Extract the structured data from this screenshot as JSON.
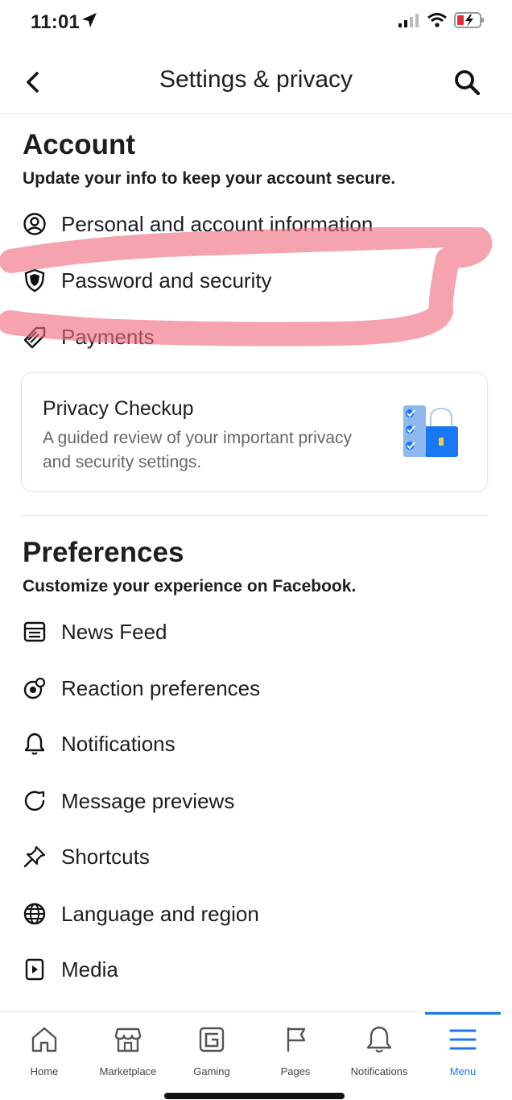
{
  "status": {
    "time": "11:01"
  },
  "header": {
    "title": "Settings & privacy"
  },
  "account": {
    "title": "Account",
    "subtitle": "Update your info to keep your account secure.",
    "items": [
      {
        "label": "Personal and account information",
        "icon": "user-circle-icon"
      },
      {
        "label": "Password and security",
        "icon": "shield-icon"
      },
      {
        "label": "Payments",
        "icon": "tag-icon"
      }
    ]
  },
  "privacy_card": {
    "title": "Privacy Checkup",
    "description": "A guided review of your important privacy and security settings."
  },
  "preferences": {
    "title": "Preferences",
    "subtitle": "Customize your experience on Facebook.",
    "items": [
      {
        "label": "News Feed",
        "icon": "news-feed-icon"
      },
      {
        "label": "Reaction preferences",
        "icon": "reaction-icon"
      },
      {
        "label": "Notifications",
        "icon": "bell-icon"
      },
      {
        "label": "Message previews",
        "icon": "message-preview-icon"
      },
      {
        "label": "Shortcuts",
        "icon": "pin-icon"
      },
      {
        "label": "Language and region",
        "icon": "globe-icon"
      },
      {
        "label": "Media",
        "icon": "media-icon"
      }
    ]
  },
  "tabbar": {
    "tabs": [
      {
        "label": "Home",
        "icon": "home-icon"
      },
      {
        "label": "Marketplace",
        "icon": "marketplace-icon"
      },
      {
        "label": "Gaming",
        "icon": "gaming-icon"
      },
      {
        "label": "Pages",
        "icon": "flag-icon"
      },
      {
        "label": "Notifications",
        "icon": "bell-icon"
      },
      {
        "label": "Menu",
        "icon": "menu-icon"
      }
    ],
    "active": "Menu"
  },
  "colors": {
    "accent": "#1877f2",
    "marker": "#f06a7f",
    "text": "#1c1e21",
    "secondary": "#65676b"
  }
}
